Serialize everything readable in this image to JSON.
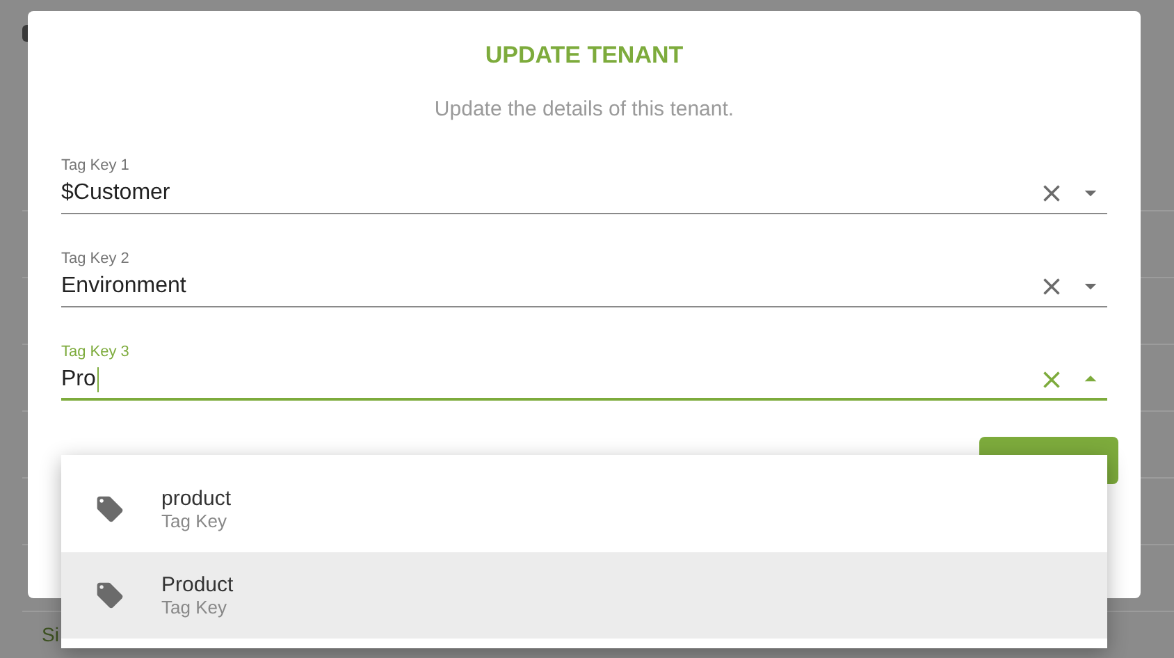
{
  "background": {
    "texts": [
      "Si"
    ]
  },
  "dialog": {
    "title": "UPDATE TENANT",
    "subtitle": "Update the details of this tenant.",
    "fields": [
      {
        "label": "Tag Key 1",
        "value": "$Customer",
        "focused": false,
        "expanded": false
      },
      {
        "label": "Tag Key 2",
        "value": "Environment",
        "focused": false,
        "expanded": false
      },
      {
        "label": "Tag Key 3",
        "value": "Pro",
        "focused": true,
        "expanded": true
      }
    ]
  },
  "suggestions": [
    {
      "name": "product",
      "type": "Tag Key",
      "selected": false
    },
    {
      "name": "Product",
      "type": "Tag Key",
      "selected": true
    }
  ]
}
